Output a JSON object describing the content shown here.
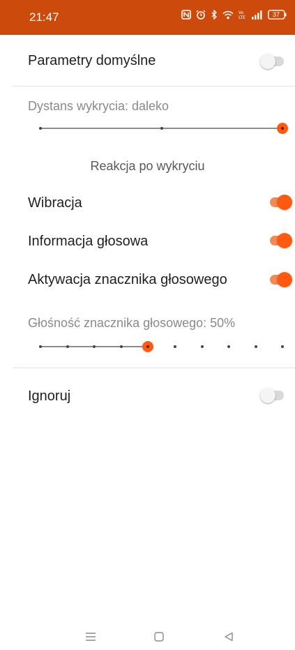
{
  "status_bar": {
    "time": "21:47",
    "battery": "37",
    "icons": [
      "nfc-icon",
      "alarm-icon",
      "bluetooth-icon",
      "wifi-icon",
      "volte-icon",
      "signal-icon",
      "battery-icon"
    ]
  },
  "settings": {
    "default_params": {
      "label": "Parametry domyślne",
      "enabled": false
    },
    "distance": {
      "label": "Dystans wykrycia: daleko",
      "level": "far",
      "steps": 3,
      "selected_index": 2
    },
    "reaction_section": "Reakcja po wykryciu",
    "vibration": {
      "label": "Wibracja",
      "enabled": true
    },
    "voice_info": {
      "label": "Informacja głosowa",
      "enabled": true
    },
    "voice_marker": {
      "label": "Aktywacja znacznika głosowego",
      "enabled": true
    },
    "marker_volume": {
      "label": "Głośność znacznika głosowego: 50%",
      "percent": 50,
      "steps": 10,
      "selected_index": 4
    },
    "ignore": {
      "label": "Ignoruj",
      "enabled": false
    }
  },
  "nav_bar": {
    "buttons": [
      "menu-icon",
      "home-icon",
      "back-icon"
    ]
  },
  "colors": {
    "status_bar": "#cc4a0b",
    "accent": "#ff5a0f",
    "accent_track": "#f38a55"
  }
}
